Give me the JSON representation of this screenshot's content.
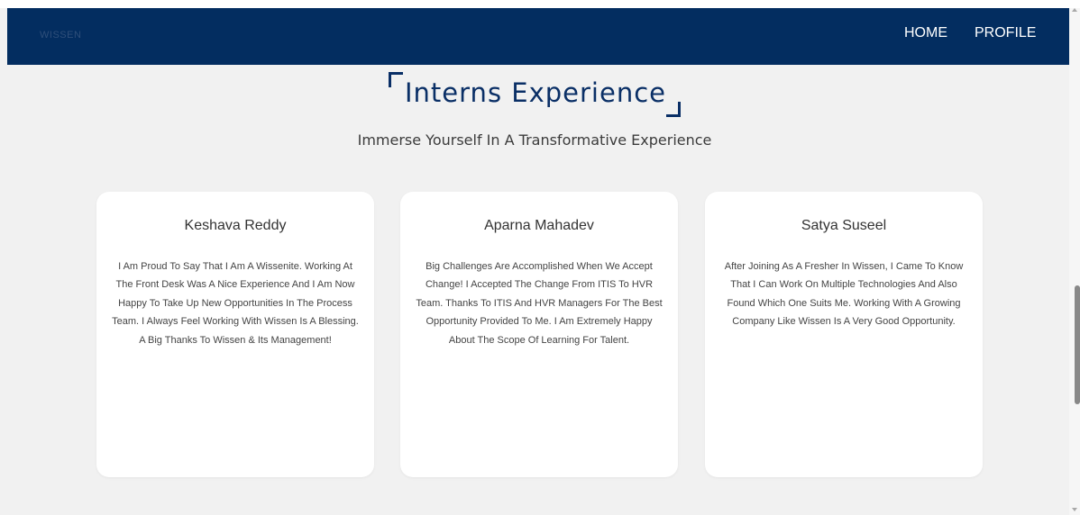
{
  "nav": {
    "logo_text": "WISSEN",
    "links": [
      {
        "label": "HOME"
      },
      {
        "label": "PROFILE"
      }
    ]
  },
  "section": {
    "title": "Interns Experience",
    "subtitle": "Immerse Yourself In A Transformative Experience"
  },
  "cards": [
    {
      "name": "Keshava Reddy",
      "text": "I Am Proud To Say That I Am A Wissenite. Working At The Front Desk Was A Nice Experience And I Am Now Happy To Take Up New Opportunities In The Process Team. I Always Feel Working With Wissen Is A Blessing. A Big Thanks To Wissen & Its Management!"
    },
    {
      "name": "Aparna Mahadev",
      "text": "Big Challenges Are Accomplished When We Accept Change! I Accepted The Change From ITIS To HVR Team. Thanks To ITIS And HVR Managers For The Best Opportunity Provided To Me. I Am Extremely Happy About The Scope Of Learning For Talent."
    },
    {
      "name": "Satya Suseel",
      "text": "After Joining As A Fresher In Wissen, I Came To Know That I Can Work On Multiple Technologies And Also Found Which One Suits Me. Working With A Growing Company Like Wissen Is A Very Good Opportunity."
    }
  ],
  "colors": {
    "navbar": "#032d60",
    "heading": "#0a2f66",
    "page_bg": "#f1f1f1",
    "card_bg": "#ffffff"
  }
}
